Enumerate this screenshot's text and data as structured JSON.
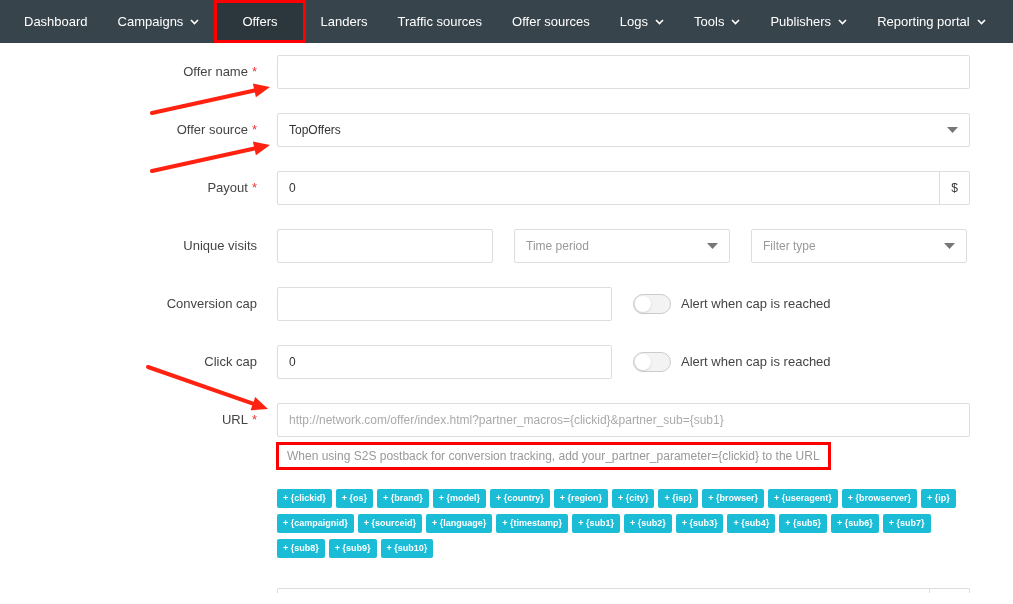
{
  "nav": [
    {
      "label": "Dashboard",
      "caret": false,
      "selected": false,
      "highlighted": false
    },
    {
      "label": "Campaigns",
      "caret": true,
      "selected": false,
      "highlighted": false
    },
    {
      "label": "Offers",
      "caret": false,
      "selected": true,
      "highlighted": true
    },
    {
      "label": "Landers",
      "caret": false,
      "selected": false,
      "highlighted": false
    },
    {
      "label": "Traffic sources",
      "caret": false,
      "selected": false,
      "highlighted": false
    },
    {
      "label": "Offer sources",
      "caret": false,
      "selected": false,
      "highlighted": false
    },
    {
      "label": "Logs",
      "caret": true,
      "selected": false,
      "highlighted": false
    },
    {
      "label": "Tools",
      "caret": true,
      "selected": false,
      "highlighted": false
    },
    {
      "label": "Publishers",
      "caret": true,
      "selected": false,
      "highlighted": false
    },
    {
      "label": "Reporting portal",
      "caret": true,
      "selected": false,
      "highlighted": false
    }
  ],
  "form": [
    {
      "kind": "text",
      "label": "Offer name",
      "required_mark": "*",
      "arrow": true
    },
    {
      "kind": "select",
      "label": "Offer source",
      "required_mark": "*",
      "arrow": true,
      "value": "TopOffers"
    },
    {
      "kind": "currency",
      "label": "Payout",
      "required_mark": "*",
      "value": "0",
      "suffix": "$"
    },
    {
      "kind": "unique",
      "label": "Unique visits",
      "selects": [
        {
          "placeholder": "Time period"
        },
        {
          "placeholder": "Filter type"
        }
      ]
    },
    {
      "kind": "cap",
      "label": "Conversion cap",
      "toggle": {
        "on": false,
        "label": "Alert when cap is reached"
      }
    },
    {
      "kind": "cap",
      "label": "Click cap",
      "value": "0",
      "toggle": {
        "on": false,
        "label": "Alert when cap is reached"
      }
    },
    {
      "kind": "url",
      "label": "URL",
      "required_mark": "*",
      "arrow": true,
      "placeholder": "http://network.com/offer/index.html?partner_macros={clickid}&partner_sub={sub1}",
      "hint": {
        "text": "When using S2S postback for conversion tracking, add your_partner_parameter={clickid} to the URL",
        "highlighted": true
      },
      "macros": [
        "+ {clickid}",
        "+ {os}",
        "+ {brand}",
        "+ {model}",
        "+ {country}",
        "+ {region}",
        "+ {city}",
        "+ {isp}",
        "+ {browser}",
        "+ {useragent}",
        "+ {browserver}",
        "+ {ip}",
        "+ {campaignid}",
        "+ {sourceid}",
        "+ {language}",
        "+ {timestamp}",
        "+ {sub1}",
        "+ {sub2}",
        "+ {sub3}",
        "+ {sub4}",
        "+ {sub5}",
        "+ {sub6}",
        "+ {sub7}",
        "+ {sub8}",
        "+ {sub9}",
        "+ {sub10}"
      ]
    }
  ]
}
